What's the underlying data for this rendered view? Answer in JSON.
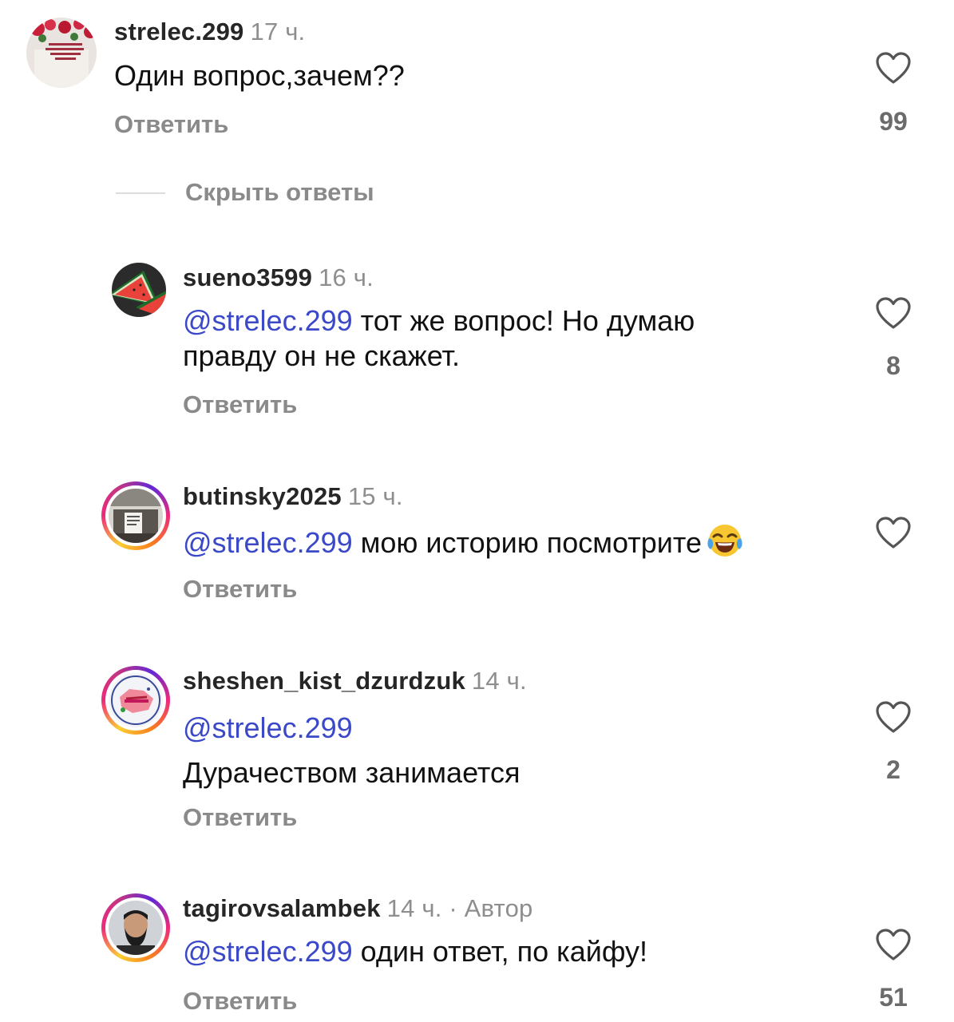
{
  "main_comment": {
    "username": "strelec.299",
    "time": "17 ч.",
    "text": "Один вопрос,зачем??",
    "reply_label": "Ответить",
    "likes": "99"
  },
  "hide_replies_label": "Скрыть ответы",
  "replies": [
    {
      "username": "sueno3599",
      "time": "16 ч.",
      "mention": "@strelec.299",
      "text_line1": " тот же вопрос! Но думаю",
      "text_line2": "правду он не скажет.",
      "reply_label": "Ответить",
      "likes": "8"
    },
    {
      "username": "butinsky2025",
      "time": "15 ч.",
      "mention": "@strelec.299",
      "text_line1": " мою историю посмотрите",
      "emoji": "face-with-tears-of-joy",
      "reply_label": "Ответить",
      "likes": ""
    },
    {
      "username": "sheshen_kist_dzurdzuk",
      "time": "14 ч.",
      "mention": "@strelec.299",
      "text_line2": "Дурачеством занимается",
      "reply_label": "Ответить",
      "likes": "2"
    },
    {
      "username": "tagirovsalambek",
      "time": "14 ч. · Автор",
      "mention": "@strelec.299",
      "text_line1": " один ответ, по кайфу!",
      "reply_label": "Ответить",
      "likes": "51"
    }
  ],
  "colors": {
    "mention": "#3b49c8",
    "muted": "#8a8a8a",
    "story_ring": [
      "#f9ce34",
      "#ee2a7b",
      "#6228d7"
    ]
  }
}
